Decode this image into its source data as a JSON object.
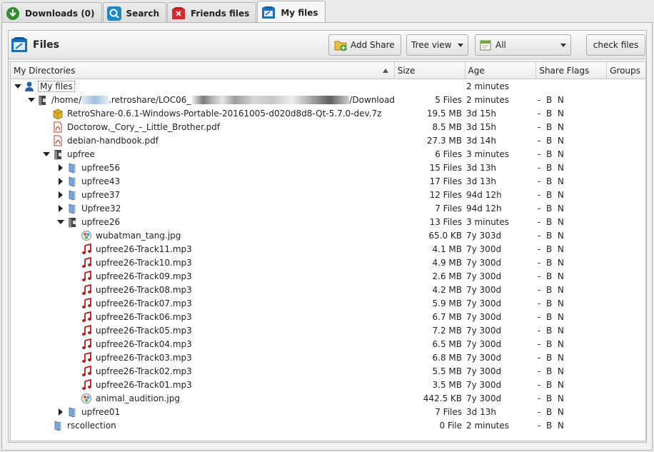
{
  "tabs": [
    {
      "label": "Downloads (0)",
      "icon": "download-icon"
    },
    {
      "label": "Search",
      "icon": "search-icon"
    },
    {
      "label": "Friends files",
      "icon": "friends-files-icon"
    },
    {
      "label": "My files",
      "icon": "my-files-icon",
      "active": true
    }
  ],
  "header": {
    "title": "Files",
    "add_share_label": "Add Share",
    "view_select": "Tree view",
    "filter_select": "All",
    "check_files_label": "check files"
  },
  "columns": [
    "My Directories",
    "Size",
    "Age",
    "Share Flags",
    "Groups"
  ],
  "rows": [
    {
      "depth": 0,
      "expand": "down",
      "icon": "user-icon",
      "name": "My files",
      "size": "",
      "age": "2 minutes",
      "flags": ""
    },
    {
      "depth": 1,
      "expand": "down",
      "icon": "shared-folder-icon",
      "name_parts": [
        "/home/",
        ".retroshare/LOC06_",
        "/Downloads"
      ],
      "size": "5 Files",
      "age": "2 minutes",
      "flags": "-  B  N"
    },
    {
      "depth": 2,
      "expand": "",
      "icon": "archive-icon",
      "name": "RetroShare-0.6.1-Windows-Portable-20161005-d020d8d8-Qt-5.7.0-dev.7z",
      "size": "19.5 MB",
      "age": "3d 15h",
      "flags": "-  B  N"
    },
    {
      "depth": 2,
      "expand": "",
      "icon": "pdf-icon",
      "name": "Doctorow,_Cory_-_Little_Brother.pdf",
      "size": "8.5 MB",
      "age": "3d 15h",
      "flags": "-  B  N"
    },
    {
      "depth": 2,
      "expand": "",
      "icon": "pdf-icon",
      "name": "debian-handbook.pdf",
      "size": "27.3 MB",
      "age": "3d 14h",
      "flags": "-  B  N"
    },
    {
      "depth": 2,
      "expand": "down",
      "icon": "shared-folder-icon",
      "name": "upfree",
      "size": "6 Files",
      "age": "3 minutes",
      "flags": "-  B  N"
    },
    {
      "depth": 3,
      "expand": "right",
      "icon": "folder-icon",
      "name": "upfree56",
      "size": "15 Files",
      "age": "3d 13h",
      "flags": "-  B  N"
    },
    {
      "depth": 3,
      "expand": "right",
      "icon": "folder-icon",
      "name": "upfree43",
      "size": "17 Files",
      "age": "3d 13h",
      "flags": "-  B  N"
    },
    {
      "depth": 3,
      "expand": "right",
      "icon": "folder-icon",
      "name": "upfree37",
      "size": "12 Files",
      "age": "94d 12h",
      "flags": "-  B  N"
    },
    {
      "depth": 3,
      "expand": "right",
      "icon": "folder-icon",
      "name": "Upfree32",
      "size": "7 Files",
      "age": "94d 12h",
      "flags": "-  B  N"
    },
    {
      "depth": 3,
      "expand": "down",
      "icon": "shared-folder-icon",
      "name": "upfree26",
      "size": "13 Files",
      "age": "3 minutes",
      "flags": "-  B  N"
    },
    {
      "depth": 4,
      "expand": "",
      "icon": "image-icon",
      "name": "wubatman_tang.jpg",
      "size": "65.0 KB",
      "age": "7y 303d",
      "flags": "-  B  N"
    },
    {
      "depth": 4,
      "expand": "",
      "icon": "music-icon",
      "name": "upfree26-Track11.mp3",
      "size": "4.1 MB",
      "age": "7y 300d",
      "flags": "-  B  N"
    },
    {
      "depth": 4,
      "expand": "",
      "icon": "music-icon",
      "name": "upfree26-Track10.mp3",
      "size": "4.9 MB",
      "age": "7y 300d",
      "flags": "-  B  N"
    },
    {
      "depth": 4,
      "expand": "",
      "icon": "music-icon",
      "name": "upfree26-Track09.mp3",
      "size": "2.6 MB",
      "age": "7y 300d",
      "flags": "-  B  N"
    },
    {
      "depth": 4,
      "expand": "",
      "icon": "music-icon",
      "name": "upfree26-Track08.mp3",
      "size": "4.2 MB",
      "age": "7y 300d",
      "flags": "-  B  N"
    },
    {
      "depth": 4,
      "expand": "",
      "icon": "music-icon",
      "name": "upfree26-Track07.mp3",
      "size": "5.9 MB",
      "age": "7y 300d",
      "flags": "-  B  N"
    },
    {
      "depth": 4,
      "expand": "",
      "icon": "music-icon",
      "name": "upfree26-Track06.mp3",
      "size": "6.7 MB",
      "age": "7y 300d",
      "flags": "-  B  N"
    },
    {
      "depth": 4,
      "expand": "",
      "icon": "music-icon",
      "name": "upfree26-Track05.mp3",
      "size": "7.2 MB",
      "age": "7y 300d",
      "flags": "-  B  N"
    },
    {
      "depth": 4,
      "expand": "",
      "icon": "music-icon",
      "name": "upfree26-Track04.mp3",
      "size": "6.5 MB",
      "age": "7y 300d",
      "flags": "-  B  N"
    },
    {
      "depth": 4,
      "expand": "",
      "icon": "music-icon",
      "name": "upfree26-Track03.mp3",
      "size": "6.8 MB",
      "age": "7y 300d",
      "flags": "-  B  N"
    },
    {
      "depth": 4,
      "expand": "",
      "icon": "music-icon",
      "name": "upfree26-Track02.mp3",
      "size": "5.5 MB",
      "age": "7y 300d",
      "flags": "-  B  N"
    },
    {
      "depth": 4,
      "expand": "",
      "icon": "music-icon",
      "name": "upfree26-Track01.mp3",
      "size": "3.5 MB",
      "age": "7y 300d",
      "flags": "-  B  N"
    },
    {
      "depth": 4,
      "expand": "",
      "icon": "image-icon",
      "name": "animal_audition.jpg",
      "size": "442.5 KB",
      "age": "7y 300d",
      "flags": "-  B  N"
    },
    {
      "depth": 3,
      "expand": "right",
      "icon": "folder-icon",
      "name": "upfree01",
      "size": "7 Files",
      "age": "3d 13h",
      "flags": "-  B  N"
    },
    {
      "depth": 2,
      "expand": "",
      "icon": "folder-icon",
      "name": "rscollection",
      "size": "0 File",
      "age": "2 minutes",
      "flags": "-  B  N"
    }
  ]
}
